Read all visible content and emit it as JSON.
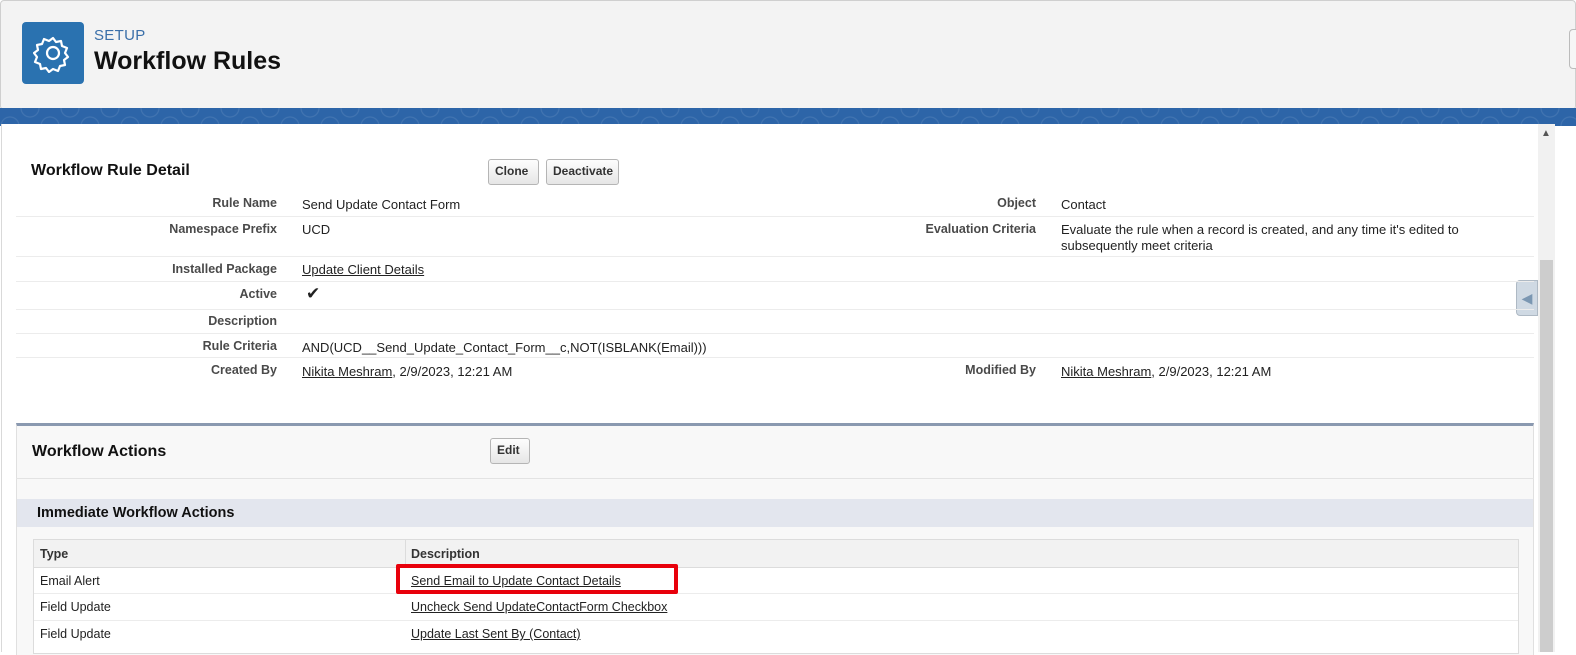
{
  "header": {
    "kicker": "SETUP",
    "title": "Workflow Rules",
    "icon": "gear-icon",
    "accent": "#2a72b0"
  },
  "detail": {
    "section_title": "Workflow Rule Detail",
    "buttons": {
      "clone": "Clone",
      "deactivate": "Deactivate"
    },
    "fields": {
      "rule_name_label": "Rule Name",
      "rule_name": "Send Update Contact Form",
      "object_label": "Object",
      "object": "Contact",
      "namespace_label": "Namespace Prefix",
      "namespace": "UCD",
      "eval_label": "Evaluation Criteria",
      "eval_line1": "Evaluate the rule when a record is created, and any time it's edited to",
      "eval_line2": "subsequently meet criteria",
      "package_label": "Installed Package",
      "package": "Update Client Details",
      "active_label": "Active",
      "active_check": "✔",
      "description_label": "Description",
      "criteria_label": "Rule Criteria",
      "criteria": "AND(UCD__Send_Update_Contact_Form__c,NOT(ISBLANK(Email)))",
      "created_label": "Created By",
      "created_user": "Nikita Meshram",
      "created_date": ", 2/9/2023, 12:21 AM",
      "modified_label": "Modified By",
      "modified_user": "Nikita Meshram",
      "modified_date": ", 2/9/2023, 12:21 AM"
    }
  },
  "actions": {
    "section_title": "Workflow Actions",
    "edit": "Edit",
    "immediate_title": "Immediate Workflow Actions",
    "columns": {
      "type": "Type",
      "description": "Description"
    },
    "rows": [
      {
        "type": "Email Alert",
        "description": "Send Email to Update Contact Details"
      },
      {
        "type": "Field Update",
        "description": "Uncheck Send UpdateContactForm Checkbox"
      },
      {
        "type": "Field Update",
        "description": "Update Last Sent By (Contact)"
      }
    ],
    "highlight_color": "#e8000b"
  }
}
